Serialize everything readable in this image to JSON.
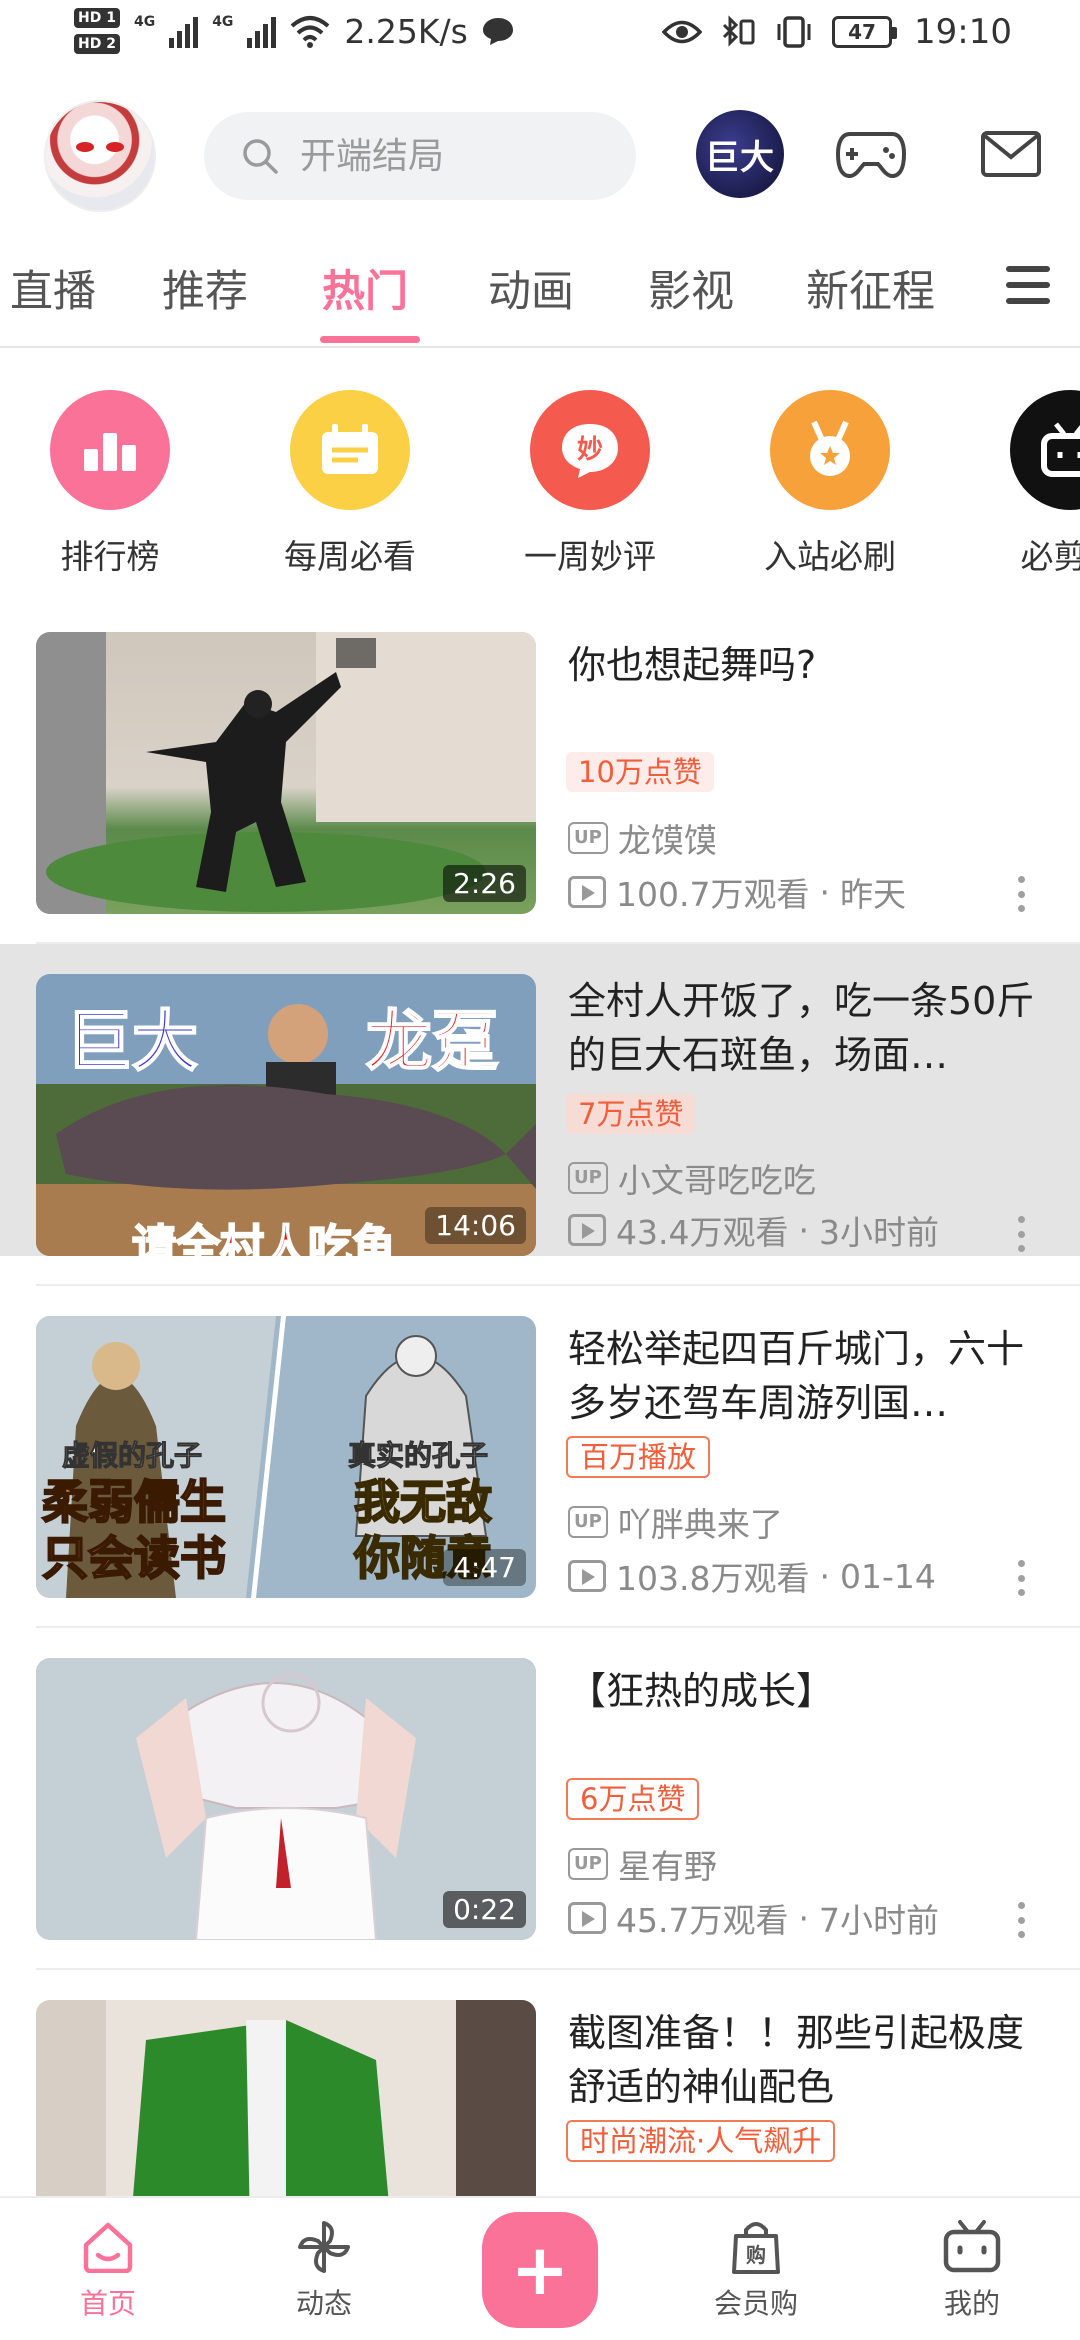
{
  "status_bar": {
    "hd1": "HD 1",
    "hd2": "HD 2",
    "net1": "4G",
    "net2": "4G",
    "speed": "2.25K/s",
    "battery": "47",
    "time": "19:10"
  },
  "header": {
    "search_placeholder": "开端结局",
    "badge_text": "巨大",
    "icons": [
      "avatar",
      "search-icon",
      "game-controller-icon",
      "mail-icon"
    ]
  },
  "tabs": [
    "直播",
    "推荐",
    "热门",
    "动画",
    "影视",
    "新征程"
  ],
  "active_tab": "热门",
  "quick_entries": [
    {
      "label": "排行榜",
      "color": "#fb7299",
      "icon": "ranking-icon"
    },
    {
      "label": "每周必看",
      "color": "#fbd045",
      "icon": "calendar-icon"
    },
    {
      "label": "一周妙评",
      "color": "#f45a4e",
      "icon": "comment-icon"
    },
    {
      "label": "入站必刷",
      "color": "#f7a13a",
      "icon": "medal-icon"
    },
    {
      "label": "必剪拐",
      "color": "#111111",
      "icon": "bilibili-icon"
    }
  ],
  "videos": [
    {
      "title": "你也想起舞吗?",
      "tag": "10万点赞",
      "uploader": "龙馍馍",
      "views": "100.7万观看",
      "time": "昨天",
      "duration": "2:26"
    },
    {
      "title": "全村人开饭了，吃一条50斤的巨大石斑鱼，场面…",
      "tag": "7万点赞",
      "uploader": "小文哥吃吃吃",
      "views": "43.4万观看",
      "time": "3小时前",
      "duration": "14:06",
      "thumb_text_1": "巨大",
      "thumb_text_2": "龙趸",
      "thumb_text_3": "请全村人吃鱼"
    },
    {
      "title": "轻松举起四百斤城门，六十多岁还驾车周游列国…",
      "tag": "百万播放",
      "uploader": "吖胖典来了",
      "views": "103.8万观看",
      "time": "01-14",
      "duration": "4:47",
      "thumb_text_1": "虚假的孔子",
      "thumb_text_2": "柔弱儒生",
      "thumb_text_3": "只会读书",
      "thumb_text_4": "真实的孔子",
      "thumb_text_5": "我无敌",
      "thumb_text_6": "你随意"
    },
    {
      "title": "【狂热的成长】",
      "tag": "6万点赞",
      "uploader": "星有野",
      "views": "45.7万观看",
      "time": "7小时前",
      "duration": "0:22"
    },
    {
      "title": "截图准备！！那些引起极度舒适的神仙配色",
      "tag": "时尚潮流·人气飙升",
      "uploader": "",
      "views": "",
      "time": "",
      "duration": ""
    }
  ],
  "labels": {
    "up": "UP",
    "dot": "·"
  },
  "bottom_nav": [
    {
      "label": "首页",
      "icon": "home-icon"
    },
    {
      "label": "动态",
      "icon": "pinwheel-icon"
    },
    {
      "label": "+",
      "icon": "plus-icon"
    },
    {
      "label": "会员购",
      "icon": "shopping-bag-icon"
    },
    {
      "label": "我的",
      "icon": "tv-icon"
    }
  ],
  "colors": {
    "accent": "#fb7299",
    "tag": "#f25d3a"
  }
}
